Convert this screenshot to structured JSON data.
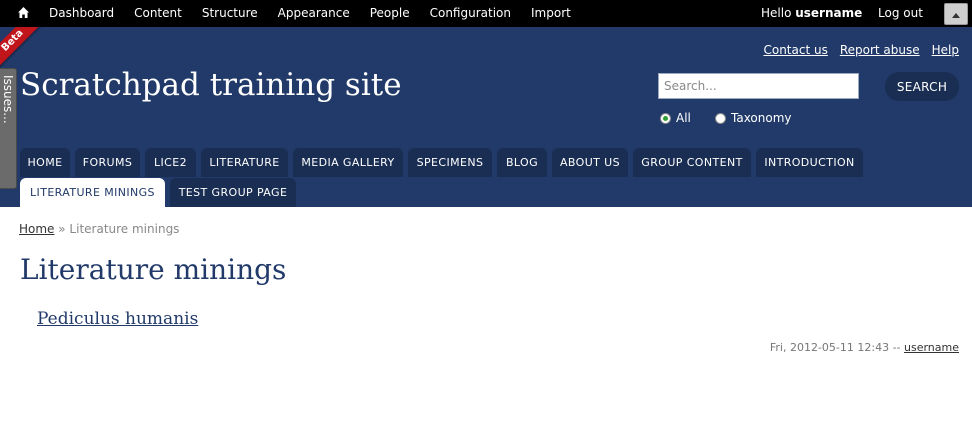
{
  "admin_bar": {
    "menu": [
      "Dashboard",
      "Content",
      "Structure",
      "Appearance",
      "People",
      "Configuration",
      "Import"
    ],
    "hello_prefix": "Hello ",
    "username": "username",
    "logout": "Log out"
  },
  "header": {
    "top_links": [
      "Contact us",
      "Report abuse",
      "Help"
    ],
    "site_title": "Scratchpad training site",
    "beta_ribbon": "Beta",
    "issues_tab": "Issues..."
  },
  "search": {
    "placeholder": "Search...",
    "button": "SEARCH",
    "options": [
      "All",
      "Taxonomy"
    ],
    "selected": "All"
  },
  "nav": {
    "row1": [
      "HOME",
      "FORUMS",
      "LICE2",
      "LITERATURE",
      "MEDIA GALLERY",
      "SPECIMENS",
      "BLOG",
      "ABOUT US",
      "GROUP CONTENT",
      "INTRODUCTION"
    ],
    "row2": [
      "LITERATURE MININGS",
      "TEST GROUP PAGE"
    ],
    "active": "LITERATURE MININGS"
  },
  "breadcrumb": {
    "home": "Home",
    "separator": " » ",
    "current": "Literature minings"
  },
  "page": {
    "title": "Literature minings",
    "entry": "Pediculus humanis",
    "meta_date": "Fri, 2012-05-11 12:43 -- ",
    "meta_user": "username"
  },
  "colors": {
    "header_bg": "#213a69",
    "tab_bg": "#192e52",
    "title_color": "#213a69",
    "admin_bar_bg": "#000000"
  }
}
